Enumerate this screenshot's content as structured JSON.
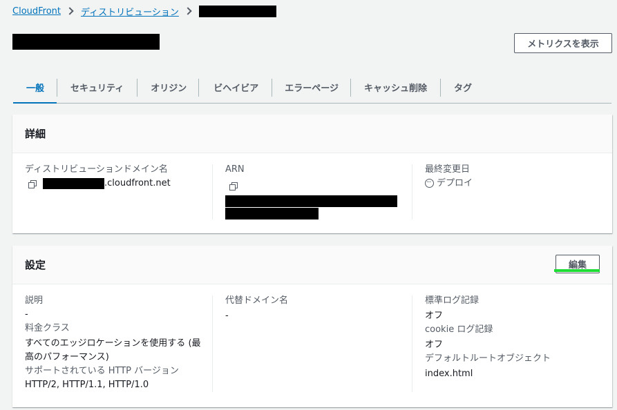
{
  "breadcrumb": {
    "root": "CloudFront",
    "section": "ディストリビューション"
  },
  "header": {
    "metrics_button": "メトリクスを表示"
  },
  "tabs": [
    "一般",
    "セキュリティ",
    "オリジン",
    "ビヘイビア",
    "エラーページ",
    "キャッシュ削除",
    "タグ"
  ],
  "details": {
    "title": "詳細",
    "domain_label": "ディストリビューションドメイン名",
    "domain_suffix": ".cloudfront.net",
    "arn_label": "ARN",
    "last_modified_label": "最終変更日",
    "last_modified_value": "デプロイ"
  },
  "settings": {
    "title": "設定",
    "edit_button": "編集",
    "description_label": "説明",
    "description_value": "-",
    "price_class_label": "料金クラス",
    "price_class_value_line1": "すべてのエッジロケーションを使用する (最",
    "price_class_value_line2": "高のパフォーマンス)",
    "http_version_label": "サポートされている HTTP バージョン",
    "http_version_value": "HTTP/2, HTTP/1.1, HTTP/1.0",
    "alt_domain_label": "代替ドメイン名",
    "alt_domain_value": "-",
    "std_log_label": "標準ログ記録",
    "std_log_value": "オフ",
    "cookie_log_label": "cookie ログ記録",
    "cookie_log_value": "オフ",
    "default_root_label": "デフォルトルートオブジェクト",
    "default_root_value": "index.html"
  }
}
